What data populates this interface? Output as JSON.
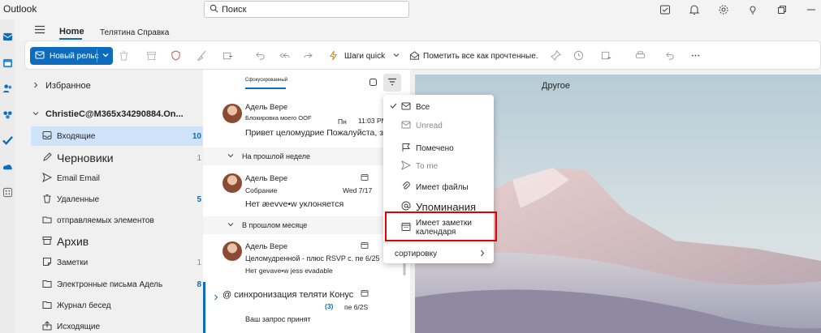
{
  "window": {
    "title": "Outlook"
  },
  "search": {
    "placeholder": "Поиск"
  },
  "menu": {
    "home": "Home",
    "other": "Телятина Справка"
  },
  "ribbon": {
    "new_mail": "Новый рельс",
    "quick_steps": "Шаги quick",
    "mark_all_read": "Пометить все как прочтенные."
  },
  "folders": {
    "favorites": "Избранное",
    "account": "ChristieC@M365x34290884.On...",
    "items": [
      {
        "label": "Входящие",
        "count": "10"
      },
      {
        "label": "Черновики",
        "count": "1"
      },
      {
        "label": "Email Email",
        "count": ""
      },
      {
        "label": "Удаленные",
        "count": "5"
      },
      {
        "label": "отправляемых элементов",
        "count": ""
      },
      {
        "label": "Архив",
        "count": ""
      },
      {
        "label": "Заметки",
        "count": "1"
      },
      {
        "label": "Электронные письма Адель",
        "count": "8"
      },
      {
        "label": "Журнал бесед",
        "count": ""
      },
      {
        "label": "Исходящие",
        "count": ""
      }
    ]
  },
  "list": {
    "tab_focused": "Сфокусированный",
    "groups": {
      "last_week": "На прошлой неделе",
      "last_month": "В прошлом месяце"
    },
    "messages": [
      {
        "sender": "Адель Вере",
        "subject": "Блокировка моего OOF",
        "day": "Пн",
        "time": "11:03 PM",
        "preview": "Привет целомудрие Пожалуйста, заблокировать очистку"
      },
      {
        "sender": "Адель Вере",
        "subject": "Собрание",
        "date": "Wed 7/17",
        "preview": "Нет æevve•w уклоняется"
      },
      {
        "sender": "Адель Вере",
        "subject": "Целомудренной - плюс RSVP с. пе 6/25",
        "preview": "Нет gevave•w jess evadable"
      },
      {
        "sender": "@ синхронизация теляти Конус",
        "count": "(3)",
        "date": "пе 6/2S",
        "preview": "Ваш запрос принят"
      }
    ]
  },
  "reading": {
    "folder_label": "Другое"
  },
  "filter_menu": {
    "items": [
      {
        "label": "Все"
      },
      {
        "label": "Unread"
      },
      {
        "label": "Помечено"
      },
      {
        "label": "To me"
      },
      {
        "label": "Имеет файлы"
      },
      {
        "label": "Упоминания"
      },
      {
        "label": "Имеет заметки календаря"
      },
      {
        "label": "сортировку"
      }
    ]
  },
  "colors": {
    "accent": "#0f6cbd",
    "highlight": "#e00000",
    "selected_folder": "#cfe4fa"
  }
}
